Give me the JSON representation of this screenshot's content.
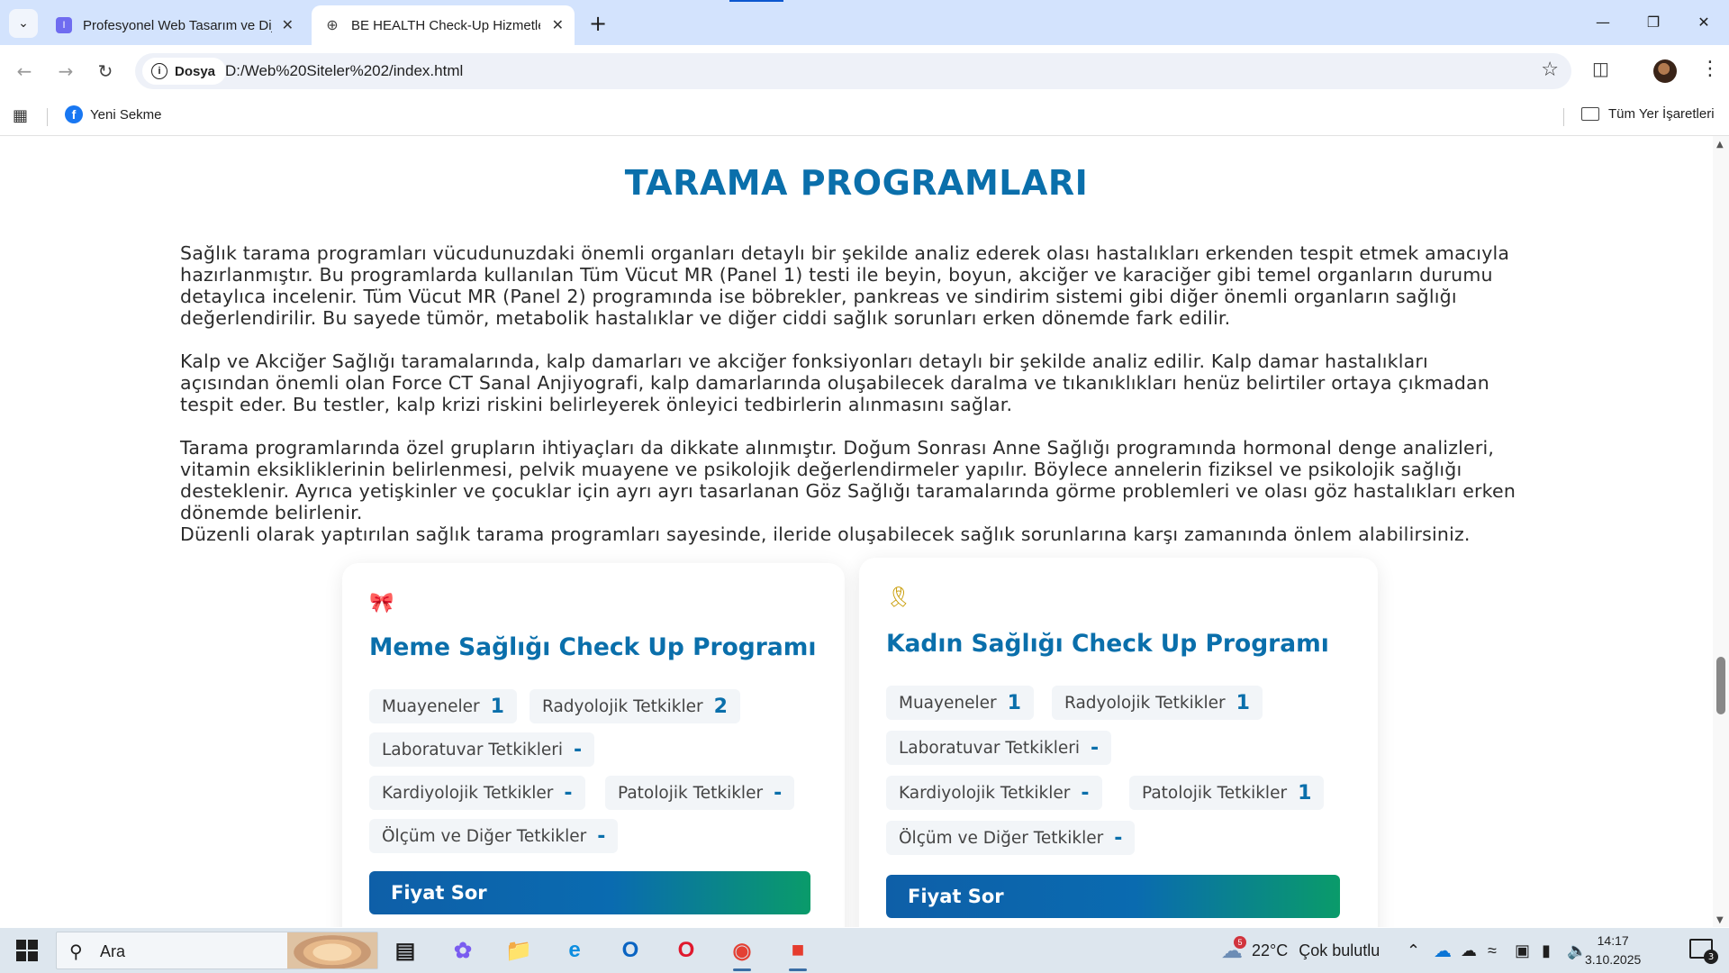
{
  "browser": {
    "tabs": [
      {
        "label": "Profesyonel Web Tasarım ve Dijital",
        "favicon": "I"
      },
      {
        "label": "BE HEALTH Check-Up Hizmetleri",
        "favicon": "⊕"
      }
    ],
    "new_tab": "+",
    "window_controls": {
      "minimize": "—",
      "restore": "❐",
      "close": "✕"
    },
    "toolbar": {
      "back": "←",
      "forward": "→",
      "reload": "↻"
    },
    "omnibox": {
      "chip_label": "Dosya",
      "url": "D:/Web%20Siteler%202/index.html"
    },
    "bookmarks": {
      "item": "Yeni Sekme",
      "all_label": "Tüm Yer İşaretleri"
    }
  },
  "page": {
    "section_title": "TARAMA PROGRAMLARI",
    "paragraphs": [
      "Sağlık tarama programları vücudunuzdaki önemli organları detaylı bir şekilde analiz ederek olası hastalıkları erkenden tespit etmek amacıyla hazırlanmıştır. Bu programlarda kullanılan Tüm Vücut MR (Panel 1) testi ile beyin, boyun, akciğer ve karaciğer gibi temel organların durumu detaylıca incelenir. Tüm Vücut MR (Panel 2) programında ise böbrekler, pankreas ve sindirim sistemi gibi diğer önemli organların sağlığı değerlendirilir. Bu sayede tümör, metabolik hastalıklar ve diğer ciddi sağlık sorunları erken dönemde fark edilir.",
      "Kalp ve Akciğer Sağlığı taramalarında, kalp damarları ve akciğer fonksiyonları detaylı bir şekilde analiz edilir. Kalp damar hastalıkları açısından önemli olan Force CT Sanal Anjiyografi, kalp damarlarında oluşabilecek daralma ve tıkanıklıkları henüz belirtiler ortaya çıkmadan tespit eder. Bu testler, kalp krizi riskini belirleyerek önleyici tedbirlerin alınmasını sağlar.",
      "Tarama programlarında özel grupların ihtiyaçları da dikkate alınmıştır. Doğum Sonrası Anne Sağlığı programında hormonal denge analizleri, vitamin eksikliklerinin belirlenmesi, pelvik muayene ve psikolojik değerlendirmeler yapılır. Böylece annelerin fiziksel ve psikolojik sağlığı desteklenir. Ayrıca yetişkinler ve çocuklar için ayrı ayrı tasarlanan Göz Sağlığı taramalarında görme problemleri ve olası göz hastalıkları erken dönemde belirlenir.",
      "Düzenli olarak yaptırılan sağlık tarama programları sayesinde, ileride oluşabilecek sağlık sorunlarına karşı zamanında önlem alabilirsiniz."
    ],
    "cards": [
      {
        "icon": "🎀",
        "title": "Meme Sağlığı Check Up Programı",
        "items": [
          {
            "label": "Muayeneler",
            "value": "1"
          },
          {
            "label": "Radyolojik Tetkikler",
            "value": "2"
          },
          {
            "label": "Laboratuvar Tetkikleri",
            "value": "-"
          },
          {
            "label": "Kardiyolojik Tetkikler",
            "value": "-"
          },
          {
            "label": "Patolojik Tetkikler",
            "value": "-"
          },
          {
            "label": "Ölçüm ve Diğer Tetkikler",
            "value": "-"
          }
        ],
        "button": "Fiyat Sor"
      },
      {
        "icon": "🎗",
        "title": "Kadın Sağlığı Check Up Programı",
        "items": [
          {
            "label": "Muayeneler",
            "value": "1"
          },
          {
            "label": "Radyolojik Tetkikler",
            "value": "1"
          },
          {
            "label": "Laboratuvar Tetkikleri",
            "value": "-"
          },
          {
            "label": "Kardiyolojik Tetkikler",
            "value": "-"
          },
          {
            "label": "Patolojik Tetkikler",
            "value": "1"
          },
          {
            "label": "Ölçüm ve Diğer Tetkikler",
            "value": "-"
          }
        ],
        "button": "Fiyat Sor"
      }
    ]
  },
  "taskbar": {
    "search_text": "Ara",
    "weather": {
      "badge": "5",
      "temp": "22°C",
      "desc": "Çok bulutlu"
    },
    "time": "14:17",
    "date": "3.10.2025",
    "notification_count": "3"
  },
  "colors": {
    "accent": "#0a6fab",
    "button_gradient_end": "#0a9b6a",
    "tabstrip": "#d3e3fd"
  }
}
